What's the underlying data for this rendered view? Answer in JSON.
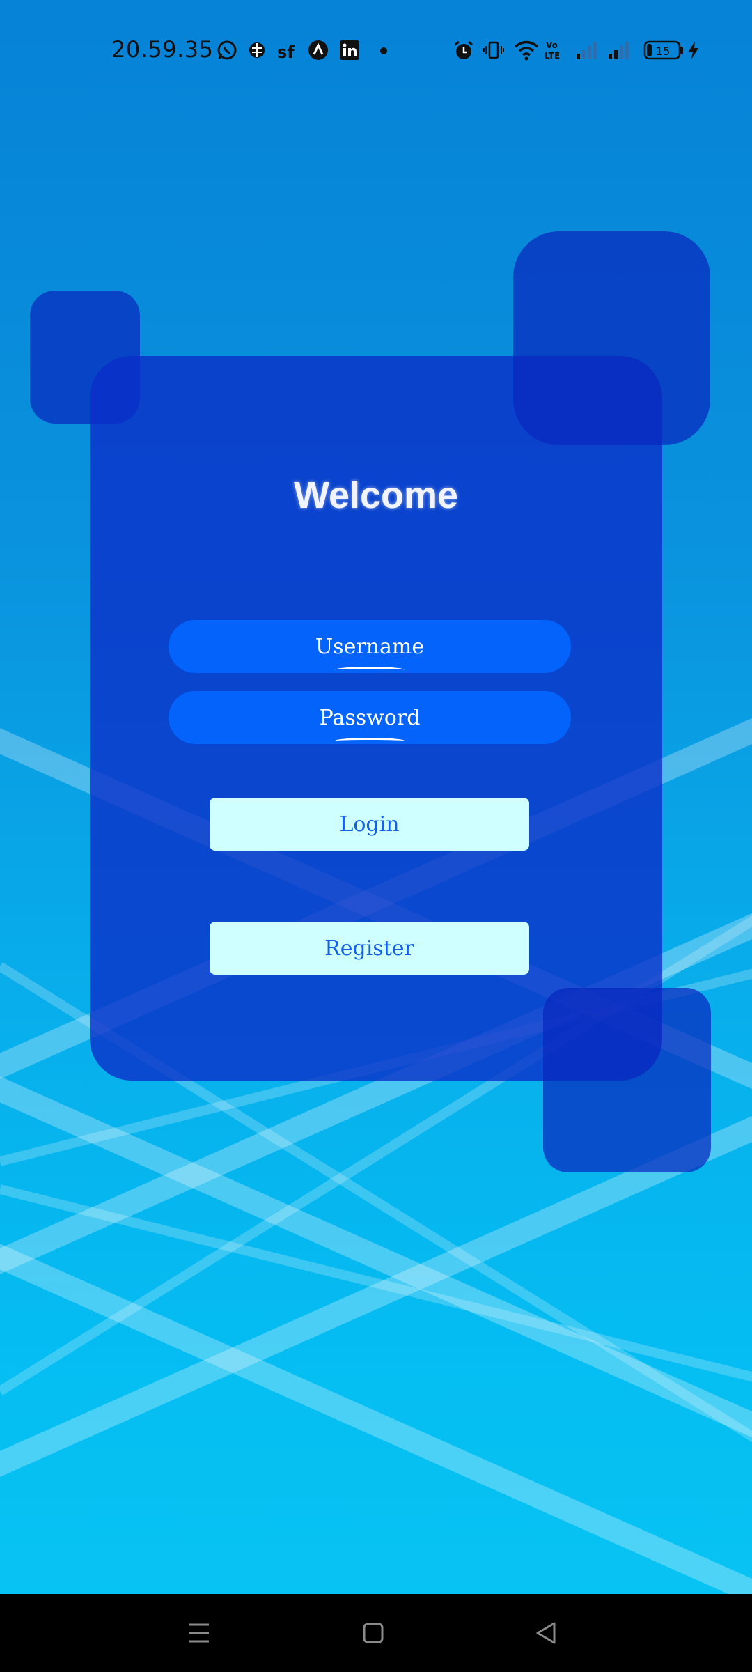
{
  "status": {
    "time": "20.59.35",
    "battery": "15",
    "left_icons": [
      "whatsapp-icon",
      "brain-icon",
      "sf-icon",
      "a-icon",
      "linkedin-icon",
      "notification-dot-icon"
    ],
    "right_icons": [
      "alarm-icon",
      "vibrate-icon",
      "wifi-icon",
      "volte-icon",
      "signal-icon",
      "signal-icon",
      "battery-icon",
      "charging-icon"
    ]
  },
  "login": {
    "title": "Welcome",
    "username_placeholder": "Username",
    "password_placeholder": "Password",
    "login_label": "Login",
    "register_label": "Register"
  },
  "nav": {
    "icons": [
      "menu-icon",
      "home-icon",
      "back-icon"
    ]
  },
  "colors": {
    "card": "#0a2dc8",
    "field": "#0463fb",
    "button": "#cfffff",
    "button_text": "#1560e6"
  }
}
